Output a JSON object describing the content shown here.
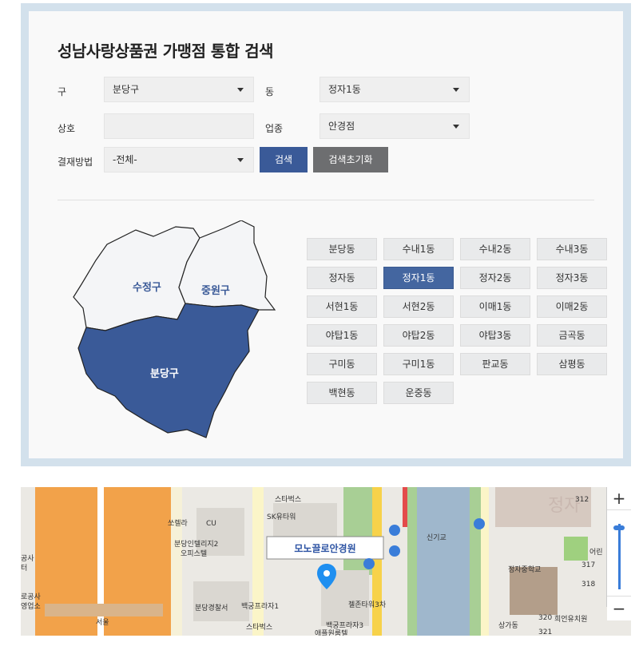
{
  "title": "성남사랑상품권 가맹점 통합 검색",
  "form": {
    "gu_label": "구",
    "gu_value": "분당구",
    "dong_label": "동",
    "dong_value": "정자1동",
    "name_label": "상호",
    "name_value": "",
    "category_label": "업종",
    "category_value": "안경점",
    "payment_label": "결재방법",
    "payment_value": "-전체-",
    "search_button": "검색",
    "reset_button": "검색초기화"
  },
  "district_map": {
    "sujeong": "수정구",
    "jungwon": "중원구",
    "bundang": "분당구",
    "selected": "분당구",
    "selected_color": "#3a5a98",
    "unselected_color": "#f4f5f7"
  },
  "dongs": [
    "분당동",
    "수내1동",
    "수내2동",
    "수내3동",
    "정자동",
    "정자1동",
    "정자2동",
    "정자3동",
    "서현1동",
    "서현2동",
    "이매1동",
    "이매2동",
    "야탑1동",
    "야탑2동",
    "야탑3동",
    "금곡동",
    "구미동",
    "구미1동",
    "판교동",
    "삼평동",
    "백현동",
    "운중동"
  ],
  "active_dong": "정자1동",
  "map": {
    "popup_label": "모노끌로안경원",
    "zoom_in": "+",
    "zoom_out": "−",
    "labels": [
      "스타벅스",
      "SK유타워",
      "쏘렐라",
      "CU",
      "분당인텔리지2",
      "오피스텔",
      "분당경찰서",
      "백궁프라자1",
      "젤존타워3차",
      "스타벅스",
      "백궁프라자3",
      "애플원룸텔",
      "신기교",
      "정자중학교",
      "희언유치원",
      "정자",
      "312",
      "317",
      "318",
      "320",
      "321",
      "공사",
      "터",
      "로공사",
      "영업소",
      "서울",
      "상가동",
      "어린"
    ]
  }
}
